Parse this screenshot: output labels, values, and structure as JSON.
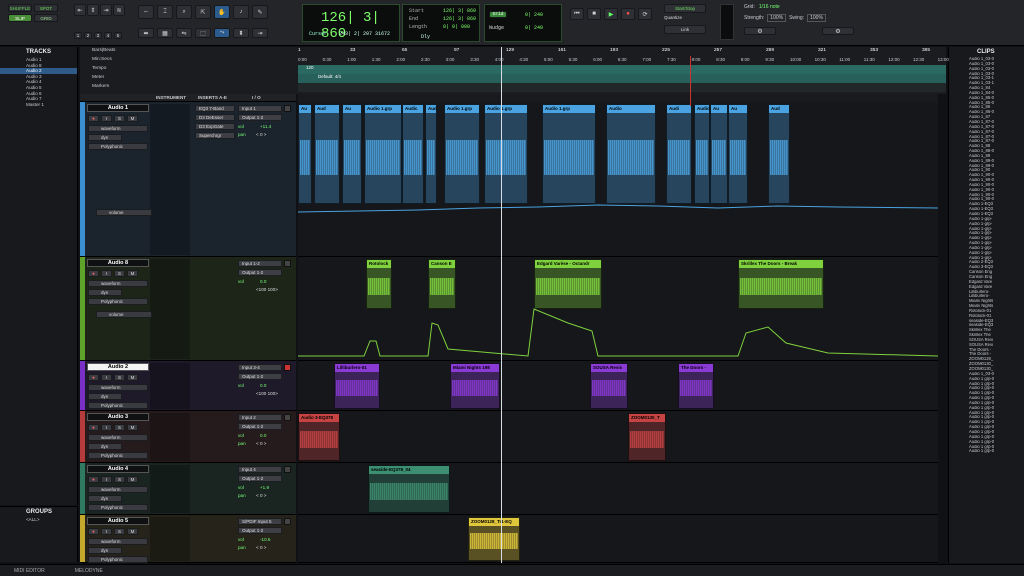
{
  "toolbar": {
    "modes": {
      "shuffle": "SHUFFLE",
      "spot": "SPOT",
      "slip": "SLIP",
      "grid": "GRID"
    },
    "mode_nums": [
      "1",
      "2",
      "3",
      "4",
      "5"
    ],
    "counter_main": "126| 3| 860",
    "cursor_label": "Cursor",
    "cursor_value": "243| 2| 207",
    "cursor_samples": "31672",
    "dly_label": "Dly",
    "start_label": "Start",
    "end_label": "End",
    "length_label": "Length",
    "start_value": "126| 3| 860",
    "end_value": "126| 3| 860",
    "length_value": "0| 0| 000",
    "grid_badge": "Grid",
    "nudge_label": "Nudge",
    "grid_val": "0| 240",
    "nudge_val": "0| 240",
    "startstop": "Start/Stop",
    "quantize": "Quantize",
    "link": "Link",
    "grid_label": "Grid:",
    "grid_note": "1/16 note",
    "strength_label": "Strength:",
    "strength": "100%",
    "swing_label": "Swing:",
    "swing": "100%"
  },
  "colors": {
    "blue": "#4aa3e0",
    "green": "#7fd13e",
    "purple": "#8a3bd6",
    "red": "#c64343",
    "teal": "#3d8f72",
    "yellow": "#e0c63a"
  },
  "tracks_panel": {
    "title": "TRACKS",
    "items": [
      "Audio 1",
      "Audio 8",
      "Audio 2",
      "Audio 3",
      "Audio 4",
      "Audio 5",
      "Audio 6",
      "Audio 7",
      "Master 1"
    ]
  },
  "groups_panel": {
    "title": "GROUPS",
    "items": [
      "<ALL>"
    ]
  },
  "bottom_tabs": [
    "MIDI EDITOR",
    "MELODYNE"
  ],
  "clips_panel": {
    "title": "CLIPS",
    "items": [
      "Audio 1_03-0",
      "Audio 1_03-0",
      "Audio 1_03-0",
      "Audio 1_03-0",
      "Audio 1_03-1",
      "Audio 1_03-1",
      "Audio 1_84",
      "Audio 1_84-0",
      "Audio 1_85-0",
      "Audio 1_85-0",
      "Audio 1_86",
      "Audio 1_86-0",
      "Audio 1_87",
      "Audio 1_87-0",
      "Audio 1_87-0",
      "Audio 1_87-0",
      "Audio 1_87-0",
      "Audio 1_87-0",
      "Audio 1_88",
      "Audio 1_88-0",
      "Audio 1_89",
      "Audio 1_89-0",
      "Audio 1_89-0",
      "Audio 1_90",
      "Audio 1_90-0",
      "Audio 1_90-0",
      "Audio 1_90-0",
      "Audio 1_90-0",
      "Audio 1_90-0",
      "Audio 1_90-0",
      "Audio 1-EQ3",
      "Audio 1-EQ3",
      "Audio 1-EQ3",
      "Audio 1-grp-",
      "Audio 1-grp-",
      "Audio 1-grp-",
      "Audio 1-grp-",
      "Audio 1-grp-",
      "Audio 1-grp-",
      "Audio 1-grp-",
      "Audio 1-grp-",
      "Audio 1-grp-",
      "Audio 2-EQ3",
      "Audio 3-EQ3",
      "Canson Eng",
      "Canson Eng",
      "Edgard Vare",
      "Edgard Vare",
      "Lilliburlero-",
      "Lilliburlero-",
      "Miami Nights",
      "Miami Nights",
      "Rotolock-01",
      "Rotolock-01",
      "seaside-EQ3",
      "seaside-EQ3",
      "Skrillex The",
      "Skrillex The",
      "SOUSA Revi",
      "SOUSA Revi",
      "The Doors -",
      "The Doors -",
      "ZOOM0128_",
      "ZOOM0130_",
      "ZOOM0130_",
      "Audio 1_03-0",
      "Audio 1 grp-0",
      "Audio 1 grp-0",
      "Audio 1 grp-0",
      "Audio 1 grp-0",
      "Audio 1 grp-0",
      "Audio 1 grp-0",
      "Audio 1 grp-0",
      "Audio 1 grp-0",
      "Audio 1 grp-0",
      "Audio 1 grp-0",
      "Audio 1 grp-0",
      "Audio 1 grp-0",
      "Audio 1 grp-0",
      "Audio 1 grp-0",
      "Audio 1 grp-0",
      "Audio 1 grp-0"
    ]
  },
  "rulers": {
    "bars": "Bars|Beats",
    "minsec": "Min:Secs",
    "tempo": "Tempo",
    "meter": "Meter",
    "markers": "Markers",
    "tempo_val": "120",
    "meter_val": "Default: 4/4"
  },
  "bar_ticks": [
    "1",
    "33",
    "65",
    "97",
    "129",
    "161",
    "193",
    "225",
    "257",
    "289",
    "321",
    "353",
    "385"
  ],
  "min_ticks": [
    "0:00",
    "0:30",
    "1:00",
    "1:30",
    "2:00",
    "2:30",
    "3:00",
    "3:30",
    "4:00",
    "4:30",
    "5:00",
    "5:30",
    "6:00",
    "6:30",
    "7:00",
    "7:30",
    "8:00",
    "8:30",
    "9:00",
    "9:30",
    "10:00",
    "10:30",
    "11:00",
    "11:30",
    "12:00",
    "12:30",
    "13:00"
  ],
  "column_headers": {
    "instrument": "INSTRUMENT",
    "inserts": "INSERTS A-E",
    "io": "I / O"
  },
  "tracks": [
    {
      "name": "Audio 1",
      "view": "waveform",
      "dyn": "dyn",
      "poly": "Polyphonic",
      "auto": "volume",
      "inserts": [
        "EQ3 7-Band",
        "D3 DeEsser",
        "D3 ExpGate",
        "Superchrgr"
      ],
      "input": "Input 1",
      "output": "Output 1-2",
      "vol": "+11.4",
      "pan": "< 0 >",
      "vol_label": "vol",
      "pan_label": "pan"
    },
    {
      "name": "Audio 8",
      "view": "waveform",
      "dyn": "dyn",
      "poly": "Polyphonic",
      "auto": "volume",
      "input": "Input 1-2",
      "output": "Output 1-2",
      "vol": "0.0",
      "pan": "<100  100>",
      "vol_label": "vol"
    },
    {
      "name": "Audio 2",
      "view": "waveform",
      "dyn": "dyn",
      "poly": "Polyphonic",
      "input": "Input 3-4",
      "output": "Output 1-2",
      "vol": "0.0",
      "pan": "<100  100>",
      "vol_label": "vol"
    },
    {
      "name": "Audio 3",
      "view": "waveform",
      "dyn": "dyn",
      "poly": "Polyphonic",
      "input": "Input 2",
      "output": "Output 1-2",
      "vol": "0.0",
      "pan": "< 0 >",
      "vol_label": "vol",
      "pan_label": "pan"
    },
    {
      "name": "Audio 4",
      "view": "waveform",
      "dyn": "dyn",
      "poly": "Polyphonic",
      "input": "Input 4",
      "output": "Output 1-2",
      "vol": "+1.9",
      "pan": "< 0 >",
      "vol_label": "vol",
      "pan_label": "pan"
    },
    {
      "name": "Audio 5",
      "view": "waveform",
      "dyn": "dyn",
      "poly": "Polyphonic",
      "input": "S/PDIF Input 5",
      "output": "Output 1-2",
      "vol": "-10.6",
      "pan": "< 0 >",
      "vol_label": "vol",
      "pan_label": "pan"
    }
  ],
  "clips": {
    "a1": [
      "Au",
      "Aud",
      "Au",
      "Audio 1.grp",
      "Audic",
      "Audio 1.grp-E",
      "Audio 1.grp",
      "Audio 1.grp",
      "Audio 1.grp",
      "Audio",
      "Audi",
      "Audio",
      "Au"
    ],
    "a8": [
      "Rotolock",
      "Canson E",
      "Edgard Varèse - Octandr",
      "Skrillex  The Doors - Break"
    ],
    "a2": [
      "Lilliburlero-01",
      "Miami Nights 198",
      "SOUSA Revis",
      "The Doors -"
    ],
    "a3": [
      "Audio 3-EQ378",
      "ZOOM0130_T"
    ],
    "a4": [
      "seaside-EQ378_04"
    ],
    "a5": [
      "ZOOM0128_Tr1-EQ"
    ]
  }
}
